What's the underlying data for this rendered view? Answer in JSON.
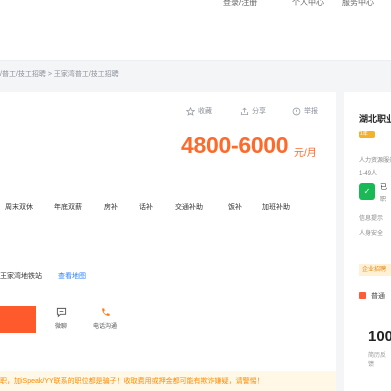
{
  "top_nav": {
    "items": [
      "登录/注册",
      "个人中心",
      "服务中心"
    ]
  },
  "breadcrumb": "/普工/技工招聘 > 王家湾普工/技工招聘",
  "actions": {
    "collect": "收藏",
    "share": "分享",
    "report": "举报"
  },
  "salary": {
    "range": "4800-6000",
    "unit": "元/月"
  },
  "benefits": [
    "周末双休",
    "年底双薪",
    "房补",
    "话补",
    "交通补助",
    "饭补",
    "加班补助"
  ],
  "location": {
    "station": "王家湾地铁站",
    "map_link": "查看地图"
  },
  "tools": {
    "chat": "微聊",
    "call": "电话沟通"
  },
  "warning": "职，加iSpeak/YY联系的职位都是骗子！收取费用或押金都可能有欺诈嫌疑，请警惕！",
  "company_panel": {
    "name": "湖北职业",
    "badge": "1年",
    "industry": "人力资源服务",
    "size": "1-49人",
    "verify_label": "已",
    "verify_sub": "职",
    "tag": "企业招聘",
    "notice": "信息提示",
    "identity": "人身安全",
    "follow_label": "普通",
    "number": "100",
    "number_sub": "简历反馈"
  }
}
